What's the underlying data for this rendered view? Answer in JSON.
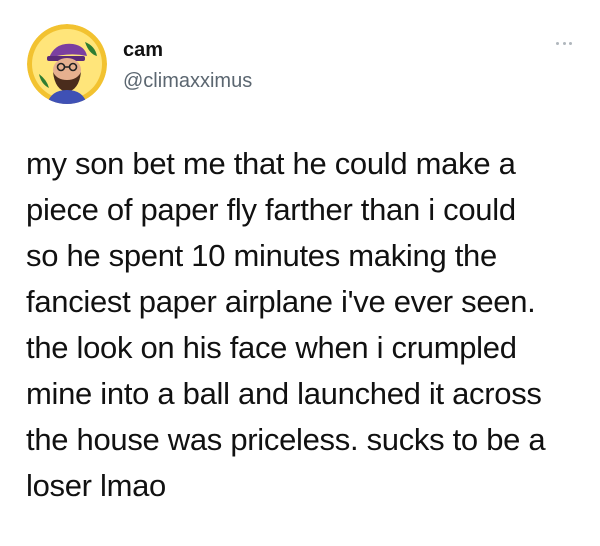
{
  "user": {
    "display_name": "cam",
    "handle": "@climaxximus",
    "avatar_icon": "profile-avatar"
  },
  "menu": {
    "icon": "more-dots-icon"
  },
  "tweet": {
    "lines": [
      "my son bet me that he could make a",
      "piece of paper fly farther than i could",
      "so he spent 10 minutes making the",
      "fanciest paper airplane i've ever seen.",
      "the look on his face when i crumpled",
      "mine into a ball and launched it across",
      "the house was priceless. sucks to be a",
      "loser lmao"
    ]
  },
  "colors": {
    "text": "#111111",
    "handle": "#5b6670",
    "avatar_ring": "#f1c232",
    "avatar_bg": "#ffe57a"
  }
}
